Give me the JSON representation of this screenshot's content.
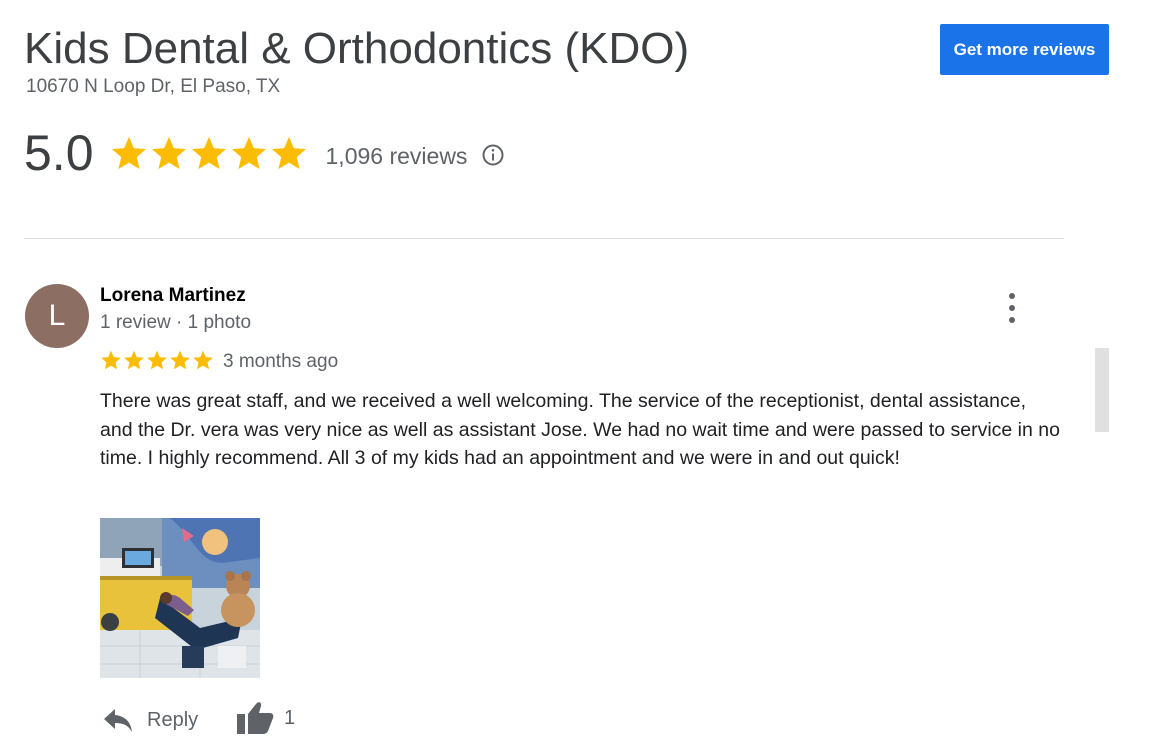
{
  "business": {
    "name": "Kids Dental & Orthodontics (KDO)",
    "address": "10670 N Loop Dr, El Paso, TX"
  },
  "header": {
    "get_more_reviews_label": "Get more reviews"
  },
  "summary": {
    "rating": "5.0",
    "stars": 5,
    "reviews_count": "1,096 reviews",
    "star_color": "#fbbc04"
  },
  "review": {
    "avatar_letter": "L",
    "author": "Lorena Martinez",
    "meta": "1 review · 1 photo",
    "stars": 5,
    "date": "3 months ago",
    "text": "There was great staff, and we received a well welcoming. The service of the receptionist, dental assistance, and the Dr. vera was very nice as well as assistant Jose. We had no wait time and were passed to service in no time. I highly recommend. All 3 of my kids had an appointment and we were in and out quick!",
    "reply_label": "Reply",
    "like_count": "1"
  },
  "colors": {
    "accent": "#1a73e8",
    "avatar_bg": "#8d6e63",
    "muted_text": "#5f6368"
  }
}
